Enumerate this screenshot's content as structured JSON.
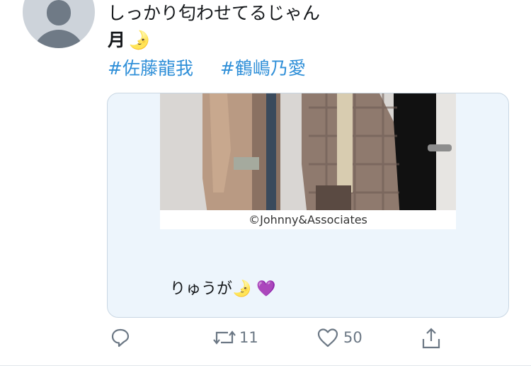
{
  "tweet": {
    "text": "しっかり匂わせてるじゃん",
    "line2_word": "月",
    "line2_emoji": "🌛",
    "hashtags": [
      "#佐藤龍我",
      "#鶴嶋乃愛"
    ]
  },
  "card": {
    "photo_caption": "©Johnny&Associates",
    "text": "りゅうが🌛 💜"
  },
  "actions": {
    "retweets": "11",
    "likes": "50"
  },
  "colors": {
    "link": "#2f8fd8",
    "card_bg": "#edf5fc",
    "icon_gray": "#6b7784"
  }
}
